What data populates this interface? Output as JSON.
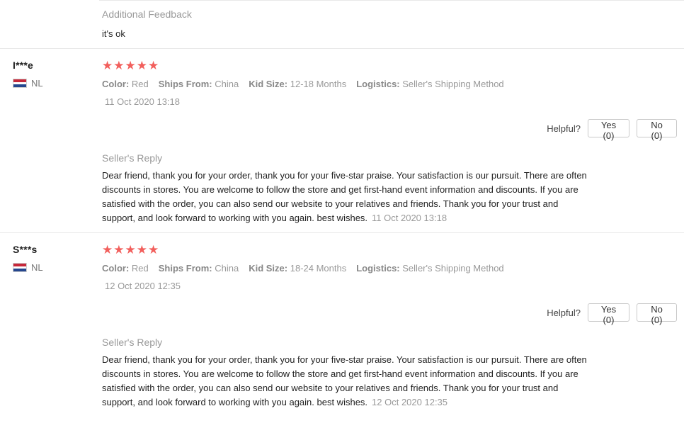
{
  "additional_feedback": {
    "title": "Additional Feedback",
    "text": "it's ok"
  },
  "reviews": [
    {
      "user": "I***e",
      "country": "NL",
      "rating": 5,
      "attributes": [
        {
          "key": "Color:",
          "value": "Red"
        },
        {
          "key": "Ships From:",
          "value": "China"
        },
        {
          "key": "Kid Size:",
          "value": "12-18 Months"
        },
        {
          "key": "Logistics:",
          "value": "Seller's Shipping Method"
        }
      ],
      "date": "11 Oct 2020 13:18",
      "helpful_label": "Helpful?",
      "yes_label": "Yes (0)",
      "no_label": "No (0)",
      "reply_title": "Seller's Reply",
      "reply_text": "Dear friend, thank you for your order, thank you for your five-star praise. Your satisfaction is our pursuit. There are often discounts in stores. You are welcome to follow the store and get first-hand event information and discounts. If you are satisfied with the order, you can also send our website to your relatives and friends. Thank you for your trust and support, and look forward to working with you again. best wishes.",
      "reply_date": "11 Oct 2020 13:18"
    },
    {
      "user": "S***s",
      "country": "NL",
      "rating": 5,
      "attributes": [
        {
          "key": "Color:",
          "value": "Red"
        },
        {
          "key": "Ships From:",
          "value": "China"
        },
        {
          "key": "Kid Size:",
          "value": "18-24 Months"
        },
        {
          "key": "Logistics:",
          "value": "Seller's Shipping Method"
        }
      ],
      "date": "12 Oct 2020 12:35",
      "helpful_label": "Helpful?",
      "yes_label": "Yes (0)",
      "no_label": "No (0)",
      "reply_title": "Seller's Reply",
      "reply_text": "Dear friend, thank you for your order, thank you for your five-star praise. Your satisfaction is our pursuit. There are often discounts in stores. You are welcome to follow the store and get first-hand event information and discounts. If you are satisfied with the order, you can also send our website to your relatives and friends. Thank you for your trust and support, and look forward to working with you again. best wishes.",
      "reply_date": "12 Oct 2020 12:35"
    }
  ],
  "colors": {
    "star": "#f25f5c",
    "muted": "#999999",
    "flag_red": "#c6283a",
    "flag_blue": "#25478e"
  },
  "icons": {
    "star": "star-icon",
    "flag": "netherlands-flag-icon"
  }
}
